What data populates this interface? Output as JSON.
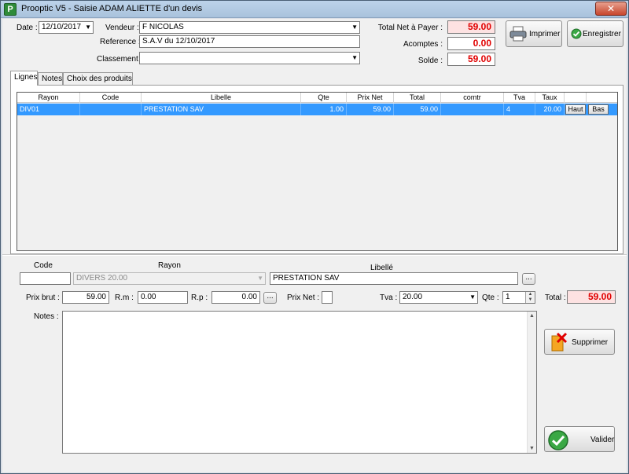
{
  "window": {
    "title": "Prooptic V5 - Saisie ADAM ALIETTE d'un devis",
    "app_icon_letter": "P",
    "close_glyph": "✕"
  },
  "header": {
    "date_label": "Date :",
    "date_value": "12/10/2017",
    "vendeur_label": "Vendeur :",
    "vendeur_value": "F NICOLAS",
    "reference_label": "Reference :",
    "reference_value": "S.A.V du 12/10/2017",
    "classement_label": "Classement :",
    "classement_value": "",
    "total_label": "Total Net à Payer :",
    "total_value": "59.00",
    "acomptes_label": "Acomptes :",
    "acomptes_value": "0.00",
    "solde_label": "Solde :",
    "solde_value": "59.00",
    "print_label": "Imprimer",
    "save_label": "Enregistrer"
  },
  "tabs": [
    "Lignes",
    "Notes",
    "Choix des produits"
  ],
  "grid": {
    "columns": [
      "Rayon",
      "Code",
      "Libelle",
      "Qte",
      "Prix Net",
      "Total",
      "comtr",
      "Tva",
      "Taux",
      "",
      ""
    ],
    "rows": [
      {
        "rayon": "DIV01",
        "code": "",
        "libelle": "PRESTATION SAV",
        "qte": "1.00",
        "prix_net": "59.00",
        "total": "59.00",
        "comtr": "",
        "tva": "4",
        "taux": "20.00",
        "up": "Haut",
        "down": "Bas"
      }
    ]
  },
  "detail": {
    "code_label": "Code",
    "code_value": "",
    "rayon_label": "Rayon",
    "rayon_value": "DIVERS 20.00",
    "libelle_label": "Libellé",
    "libelle_value": "PRESTATION SAV",
    "ellipsis": "...",
    "prix_brut_label": "Prix brut :",
    "prix_brut_value": "59.00",
    "rm_label": "R.m :",
    "rm_value": "0.00",
    "rp_label": "R.p :",
    "rp_value": "0.00",
    "prix_net_label": "Prix Net :",
    "tva_label": "Tva :",
    "tva_value": "20.00",
    "qte_label": "Qte :",
    "qte_value": "1",
    "total_label": "Total :",
    "total_value": "59.00",
    "notes_label": "Notes :",
    "notes_value": "",
    "delete_label": "Supprimer",
    "validate_label": "Valider"
  },
  "colors": {
    "amount_red": "#e00000",
    "selection": "#3399ff"
  }
}
